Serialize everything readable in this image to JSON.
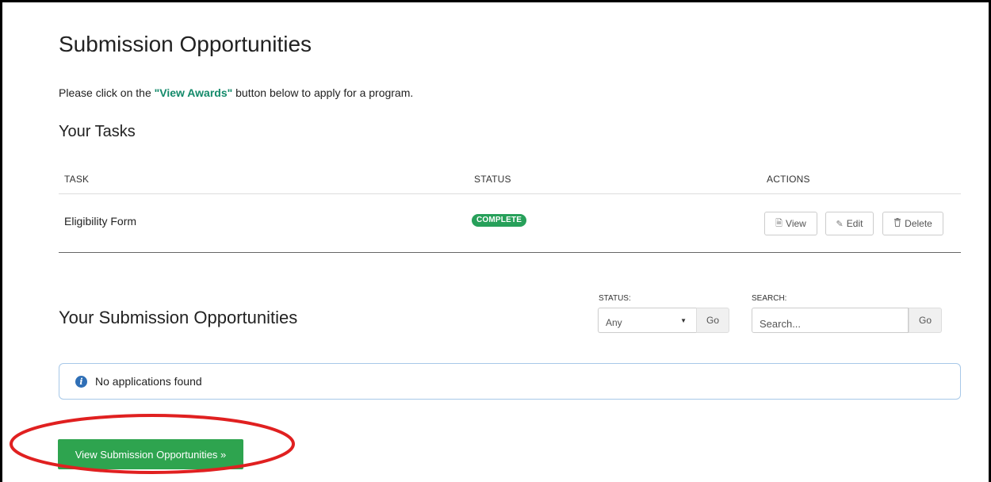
{
  "page": {
    "title": "Submission Opportunities",
    "intro_before": "Please click on the ",
    "intro_highlight": "\"View Awards\"",
    "intro_after": " button below to apply for a program."
  },
  "tasks": {
    "heading": "Your Tasks",
    "columns": {
      "task": "TASK",
      "status": "STATUS",
      "actions": "ACTIONS"
    },
    "rows": [
      {
        "task": "Eligibility Form",
        "status": "COMPLETE",
        "actions": {
          "view": "View",
          "edit": "Edit",
          "delete": "Delete"
        }
      }
    ]
  },
  "opportunities": {
    "heading": "Your Submission Opportunities",
    "status_filter": {
      "label": "STATUS:",
      "selected": "Any",
      "go": "Go"
    },
    "search": {
      "label": "SEARCH:",
      "placeholder": "Search...",
      "go": "Go"
    },
    "empty_message": "No applications found"
  },
  "cta": {
    "label": "View Submission Opportunities »"
  },
  "icons": {
    "view": "document-icon",
    "edit": "pencil-icon",
    "delete": "trash-icon",
    "info": "info-icon",
    "caret": "caret-down-icon"
  },
  "colors": {
    "accent_green": "#2ea44f",
    "badge_green": "#27a05a",
    "link_teal": "#138a6a",
    "annotation_red": "#e02020",
    "info_blue": "#2f6fb6"
  }
}
